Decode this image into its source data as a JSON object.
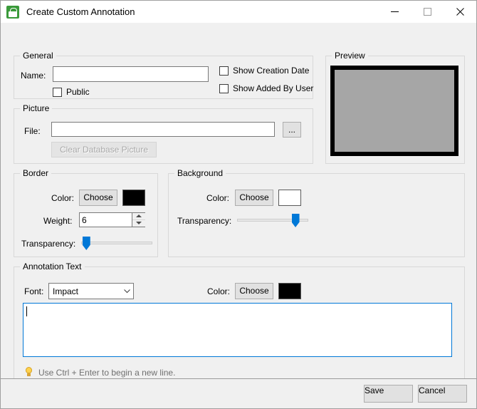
{
  "window": {
    "title": "Create Custom Annotation",
    "icon": "lock-app-icon",
    "controls": {
      "minimize": "minimize-button",
      "maximize": "maximize-button",
      "close": "close-button"
    }
  },
  "general": {
    "legend": "General",
    "name_label": "Name:",
    "name_value": "",
    "name_placeholder": "",
    "public_label": "Public",
    "public_checked": false,
    "show_creation_date_label": "Show Creation Date",
    "show_creation_date_checked": false,
    "show_added_by_user_label": "Show Added By User",
    "show_added_by_user_checked": false
  },
  "preview": {
    "legend": "Preview",
    "border_color": "#000000",
    "fill_color": "#a6a6a6"
  },
  "picture": {
    "legend": "Picture",
    "file_label": "File:",
    "file_value": "",
    "file_placeholder": "",
    "browse_label": "...",
    "clear_label": "Clear Database Picture",
    "clear_disabled": true
  },
  "border": {
    "legend": "Border",
    "color_label": "Color:",
    "choose_label": "Choose",
    "color_value": "#000000",
    "weight_label": "Weight:",
    "weight_value": "6",
    "transparency_label": "Transparency:",
    "transparency_percent": 2
  },
  "background": {
    "legend": "Background",
    "color_label": "Color:",
    "choose_label": "Choose",
    "color_value": "#ffffff",
    "transparency_label": "Transparency:",
    "transparency_percent": 86
  },
  "annotation_text": {
    "legend": "Annotation Text",
    "font_label": "Font:",
    "font_value": "Impact",
    "color_label": "Color:",
    "choose_label": "Choose",
    "color_value": "#000000",
    "text_value": "",
    "text_placeholder": "",
    "hint": "Use Ctrl + Enter to begin a new line.",
    "hint_icon": "lightbulb-icon"
  },
  "footer": {
    "save_label": "Save",
    "cancel_label": "Cancel"
  }
}
